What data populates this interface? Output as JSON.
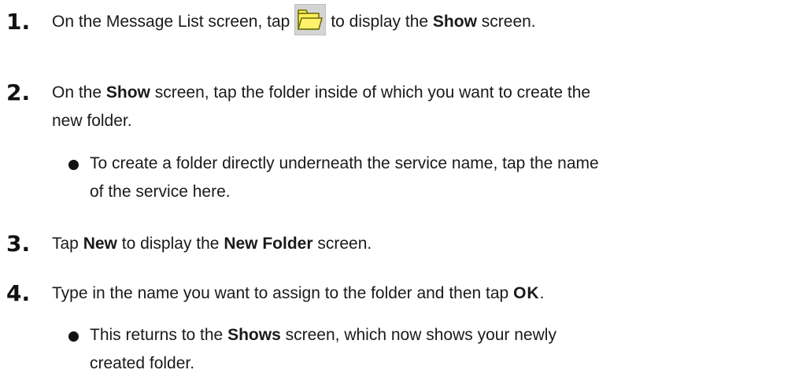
{
  "steps": [
    {
      "number": "1.",
      "before": "On the Message List screen, tap",
      "icon": "folder-icon",
      "after_pre": "to display the",
      "bold": "Show",
      "after_post": "screen."
    },
    {
      "number": "2.",
      "line1_pre": "On the",
      "line1_bold": "Show",
      "line1_post": "screen, tap the folder inside of which you want to create the",
      "line2": "new folder.",
      "bullet_line1": "To create a folder directly underneath the service name, tap the name",
      "bullet_line2": "of the service here."
    },
    {
      "number": "3.",
      "pre": "Tap",
      "bold1": "New",
      "mid": "to display the",
      "bold2": "New Folder",
      "post": "screen."
    },
    {
      "number": "4.",
      "pre": "Type in the name you want to assign to the folder and then tap",
      "bold": "OK",
      "post": ".",
      "bullet_line1_pre": "This returns to the",
      "bullet_line1_bold": "Shows",
      "bullet_line1_post": "screen, which now shows your newly",
      "bullet_line2": "created folder."
    }
  ],
  "colors": {
    "text": "#1a1a1a",
    "folder_fill": "#ffef5a",
    "folder_stroke": "#6b6b00",
    "icon_bg": "#d4d4d4"
  }
}
